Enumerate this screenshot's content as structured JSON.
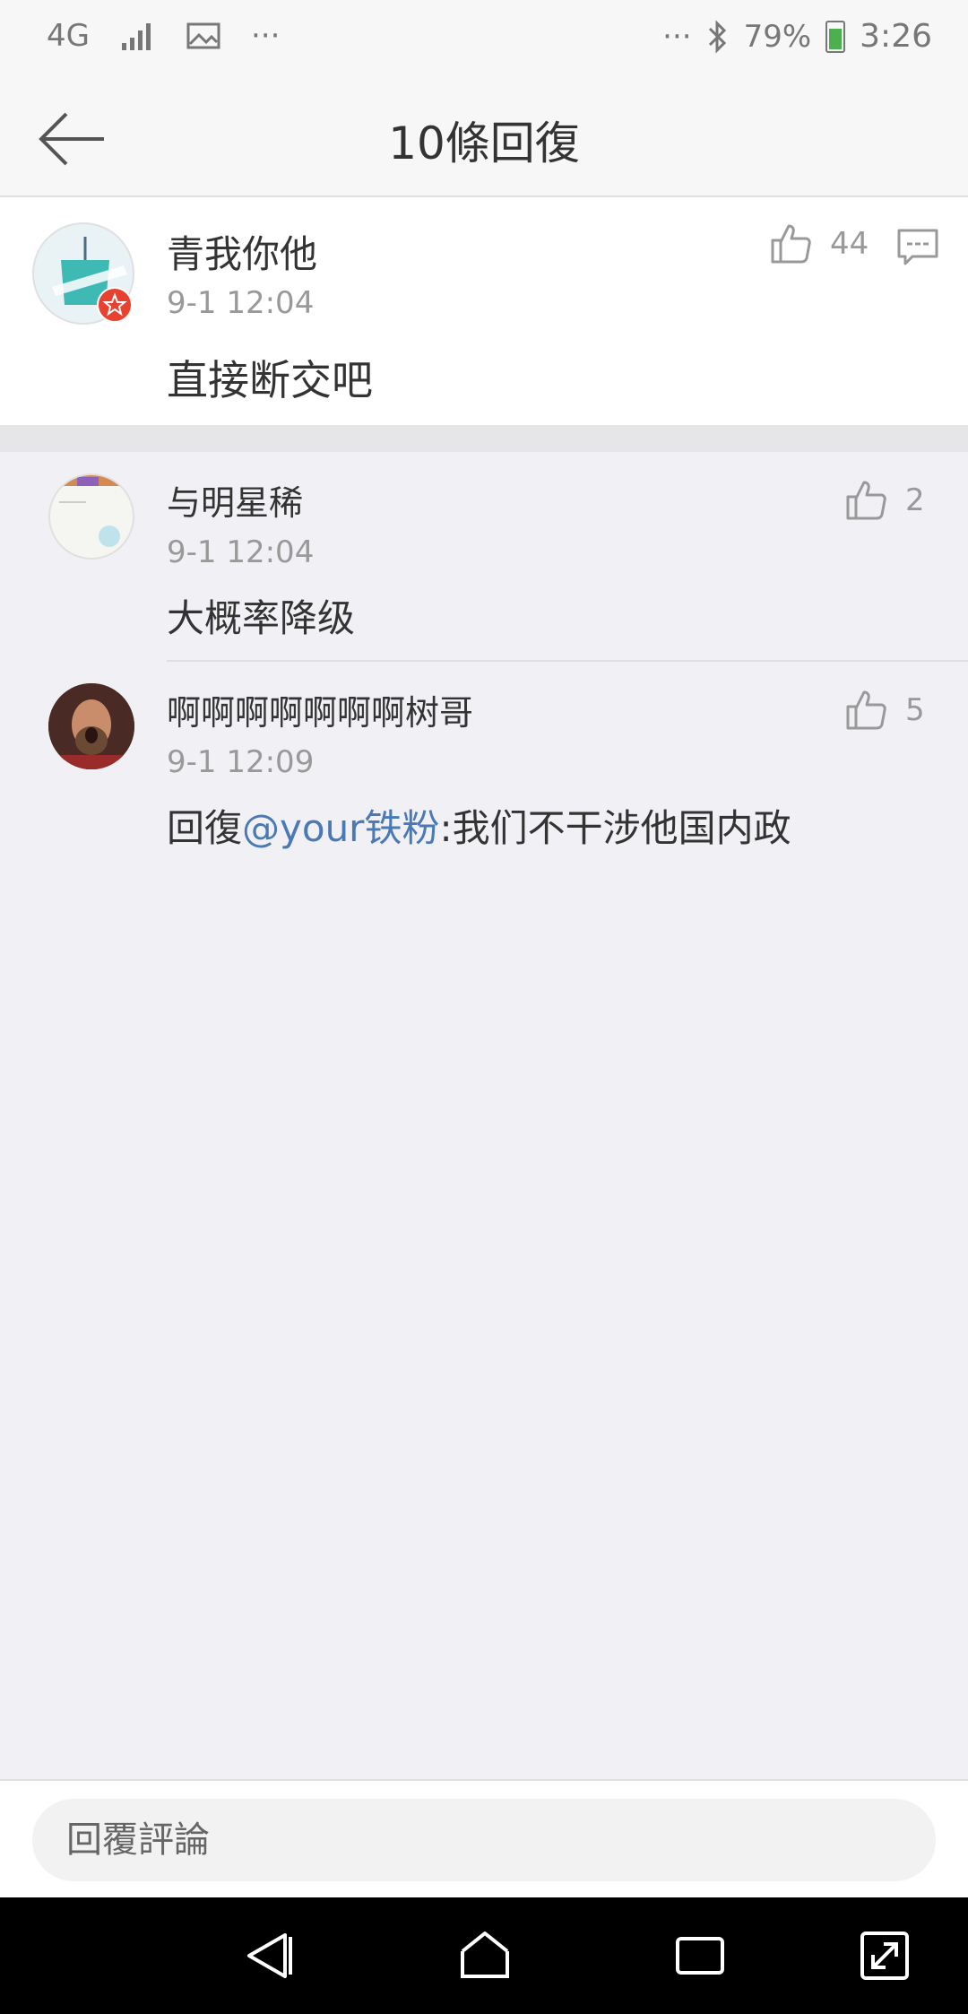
{
  "status_bar": {
    "network": "4G",
    "more_left": "···",
    "more_right": "···",
    "battery": "79%",
    "time": "3:26"
  },
  "header": {
    "title": "10條回復"
  },
  "main_comment": {
    "username": "青我你他",
    "timestamp": "9-1 12:04",
    "text": "直接断交吧",
    "like_count": "44"
  },
  "replies": [
    {
      "username": "与明星稀",
      "timestamp": "9-1 12:04",
      "text": "大概率降级",
      "like_count": "2"
    },
    {
      "username": "啊啊啊啊啊啊啊树哥",
      "timestamp": "9-1 12:09",
      "text_prefix": "回復",
      "mention": "@your铁粉",
      "text_suffix": ":我们不干涉他国内政",
      "like_count": "5"
    }
  ],
  "reply_input": {
    "placeholder": "回覆評論"
  },
  "colors": {
    "accent_link": "#4a7ab5",
    "badge": "#e8412f",
    "background": "#f1f1f5"
  }
}
